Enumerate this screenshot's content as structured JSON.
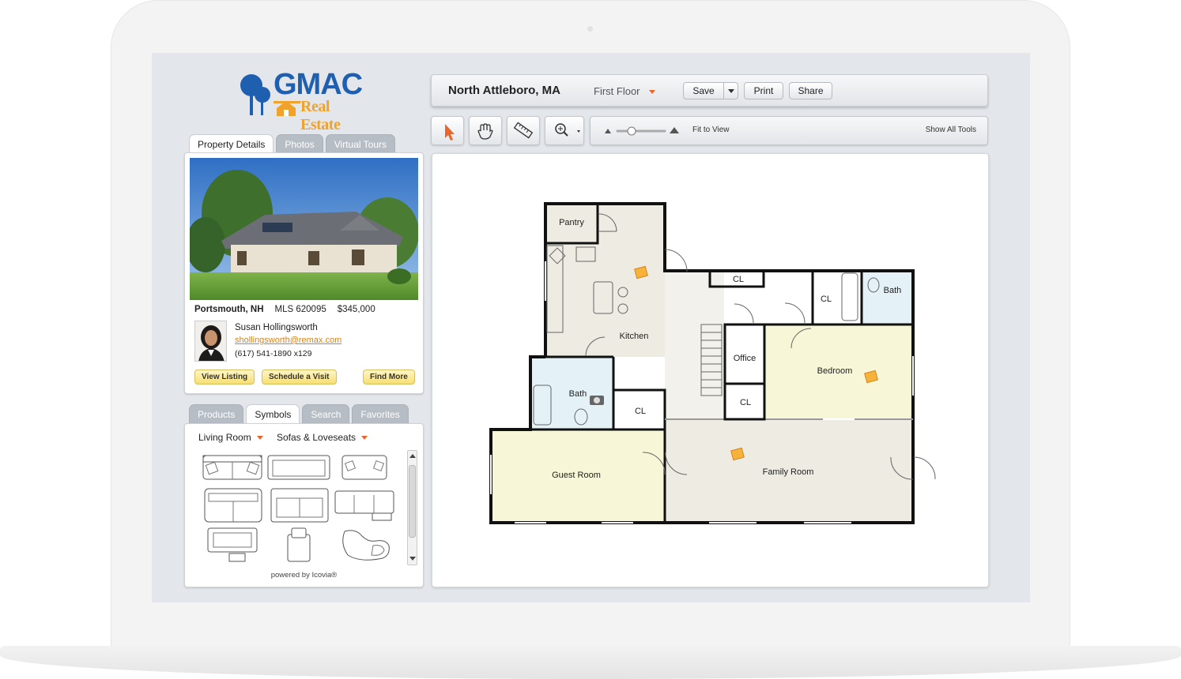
{
  "brand": {
    "line1": "GMAC",
    "line2": "Real Estate"
  },
  "property_tabs": [
    "Property Details",
    "Photos",
    "Virtual Tours"
  ],
  "property": {
    "city": "Portsmouth, NH",
    "mls": "MLS 620095",
    "price": "$345,000"
  },
  "agent": {
    "name": "Susan Hollingsworth",
    "email": "shollingsworth@remax.com",
    "phone": "(617) 541-1890 x129"
  },
  "property_buttons": {
    "view_listing": "View Listing",
    "schedule": "Schedule a Visit",
    "find_more": "Find More"
  },
  "catalog_tabs": [
    "Products",
    "Symbols",
    "Search",
    "Favorites"
  ],
  "catalog": {
    "room": "Living Room",
    "category": "Sofas & Loveseats",
    "powered_by": "powered by Icovia®"
  },
  "toolbar": {
    "location": "North Attleboro, MA",
    "floor": "First Floor",
    "save": "Save",
    "print": "Print",
    "share": "Share"
  },
  "tools": {
    "fit_to_view": "Fit to View",
    "show_all": "Show All Tools",
    "zoom_level": 0.3
  },
  "rooms": {
    "pantry": "Pantry",
    "kitchen": "Kitchen",
    "bath1": "Bath",
    "cl1": "CL",
    "cl2": "CL",
    "cl3": "CL",
    "bath2": "Bath",
    "office": "Office",
    "cl4": "CL",
    "bedroom": "Bedroom",
    "guest": "Guest Room",
    "family": "Family Room"
  },
  "colors": {
    "accent": "#e8672a",
    "link": "#d9821c",
    "brand_blue": "#1f5fb0",
    "room_yellow": "#f7f6d6",
    "room_beige": "#eeebe3",
    "bath_blue": "#e4f1f6"
  }
}
